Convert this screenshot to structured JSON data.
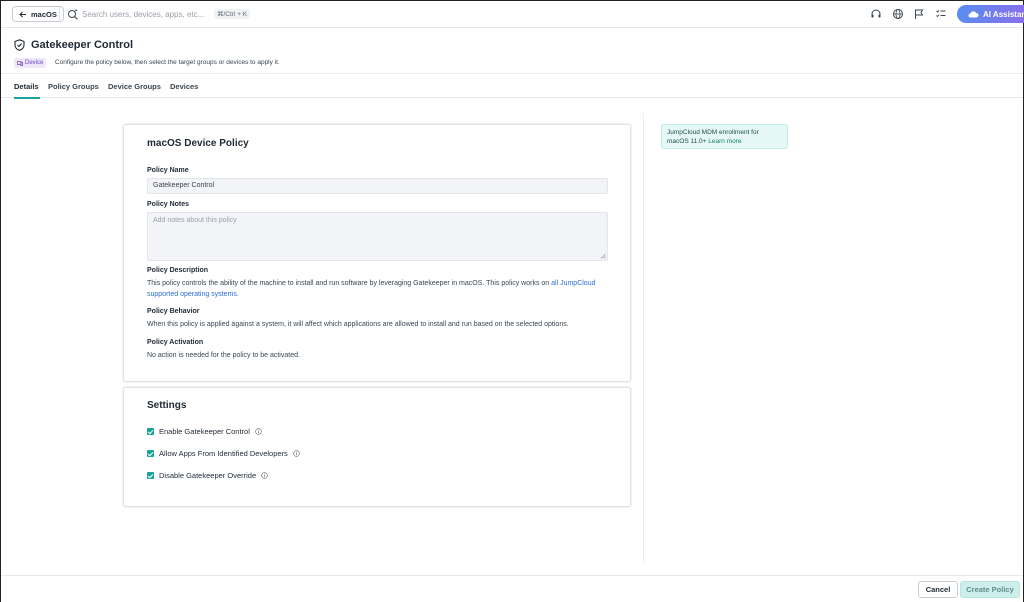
{
  "topbar": {
    "back_label": "macOS",
    "search_placeholder": "Search users, devices, apps, etc...",
    "shortcut": "⌘/Ctrl + K",
    "ai_label": "AI Assistant"
  },
  "header": {
    "title": "Gatekeeper Control",
    "badge": "Device",
    "subtitle": "Configure the policy below, then select the target groups or devices to apply it."
  },
  "tabs": [
    {
      "label": "Details",
      "active": true
    },
    {
      "label": "Policy Groups",
      "active": false
    },
    {
      "label": "Device Groups",
      "active": false
    },
    {
      "label": "Devices",
      "active": false
    }
  ],
  "policy_card": {
    "title": "macOS Device Policy",
    "name_label": "Policy Name",
    "name_value": "Gatekeeper Control",
    "notes_label": "Policy Notes",
    "notes_placeholder": "Add notes about this policy",
    "description_label": "Policy Description",
    "description_text": "This policy controls the ability of the machine to install and run software by leveraging Gatekeeper in macOS. This policy works on ",
    "description_link": "all JumpCloud supported operating systems.",
    "behavior_label": "Policy Behavior",
    "behavior_text": "When this policy is applied against a system, it will affect which applications are allowed to install and run based on the selected options.",
    "activation_label": "Policy Activation",
    "activation_text": "No action is needed for the policy to be activated."
  },
  "settings_card": {
    "title": "Settings",
    "options": [
      {
        "label": "Enable Gatekeeper Control",
        "checked": true
      },
      {
        "label": "Allow Apps From Identified Developers",
        "checked": true
      },
      {
        "label": "Disable Gatekeeper Override",
        "checked": true
      }
    ]
  },
  "notice": {
    "text": "JumpCloud MDM enrollment for macOS 11.0+ ",
    "link": "Learn more"
  },
  "footer": {
    "cancel_label": "Cancel",
    "create_label": "Create Policy"
  },
  "colors": {
    "accent": "#1aa39a",
    "link": "#2b6fd6",
    "badge_bg": "#efe8fb",
    "badge_text": "#6b44c2"
  },
  "icons": {
    "back": "arrow-left-icon",
    "search": "search-sparkle-icon",
    "support": "headset-icon",
    "language": "globe-icon",
    "flag": "flag-icon",
    "tasks": "checklist-icon",
    "ai": "cloud-sparkle-icon",
    "title": "shield-check-icon",
    "info": "info-icon"
  }
}
